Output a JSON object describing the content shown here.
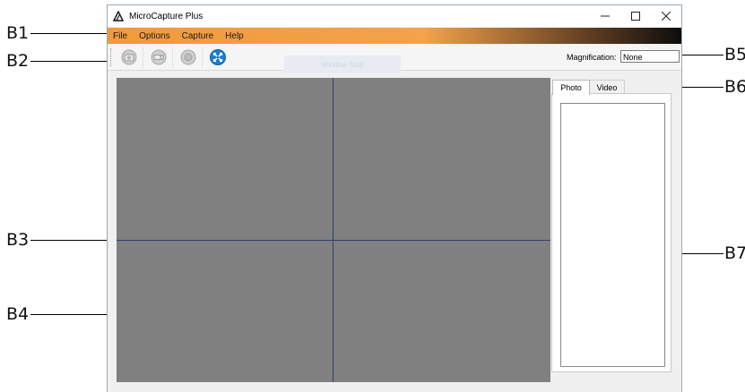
{
  "window": {
    "title": "MicroCapture Plus",
    "controls": [
      "minimize",
      "maximize",
      "close"
    ]
  },
  "menu": {
    "items": [
      {
        "label": "File"
      },
      {
        "label": "Options"
      },
      {
        "label": "Capture"
      },
      {
        "label": "Help"
      }
    ]
  },
  "toolbar": {
    "buttons": [
      {
        "icon": "camera-snapshot-icon"
      },
      {
        "icon": "video-record-icon"
      },
      {
        "icon": "stop-icon"
      },
      {
        "icon": "settings-expand-icon"
      }
    ],
    "ghost_text": "Window Stop",
    "magnification_label": "Magnification:",
    "magnification_value": "None"
  },
  "tabs": [
    {
      "label": "Photo",
      "active": true
    },
    {
      "label": "Video",
      "active": false
    }
  ],
  "callouts": [
    "B1",
    "B2",
    "B3",
    "B4",
    "B5",
    "B6",
    "B7"
  ],
  "colors": {
    "menubar_start": "#f09b3a",
    "menubar_end": "#0d0d0d",
    "preview_bg": "#808080",
    "crosshair": "#2c3e7a"
  }
}
